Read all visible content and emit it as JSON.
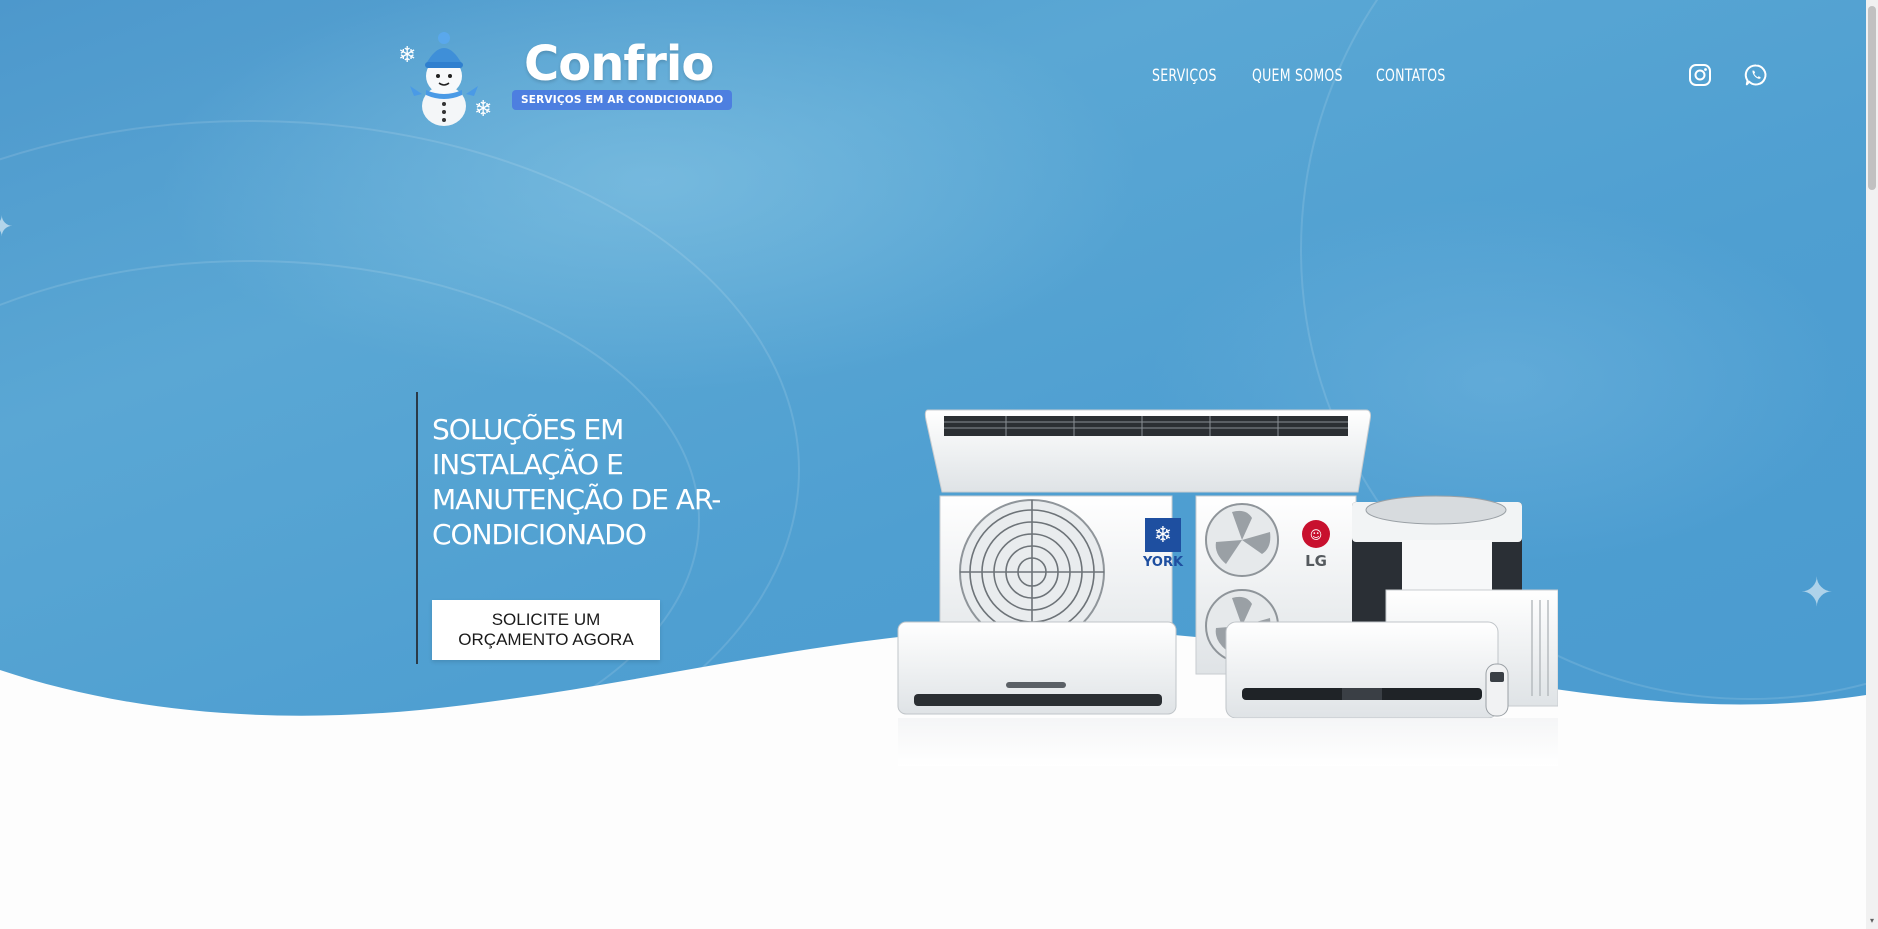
{
  "brand": {
    "name": "Confrio",
    "tagline": "SERVIÇOS EM AR CONDICIONADO"
  },
  "nav": {
    "items": [
      {
        "label": "SERVIÇOS"
      },
      {
        "label": "QUEM SOMOS"
      },
      {
        "label": "CONTATOS"
      }
    ]
  },
  "social": {
    "instagram_icon": "instagram-icon",
    "whatsapp_icon": "whatsapp-icon"
  },
  "hero": {
    "title": "SOLUÇÕES EM INSTALAÇÃO E MANUTENÇÃO DE AR-CONDICIONADO",
    "cta_label": "SOLICITE UM ORÇAMENTO AGORA"
  },
  "products": {
    "brand_york": "YORK",
    "brand_lg": "LG"
  },
  "colors": {
    "hero_blue": "#4f9fd1",
    "tag_blue": "#4d7fe0",
    "lg_red": "#c8102e",
    "york_blue": "#1e4fa0"
  }
}
